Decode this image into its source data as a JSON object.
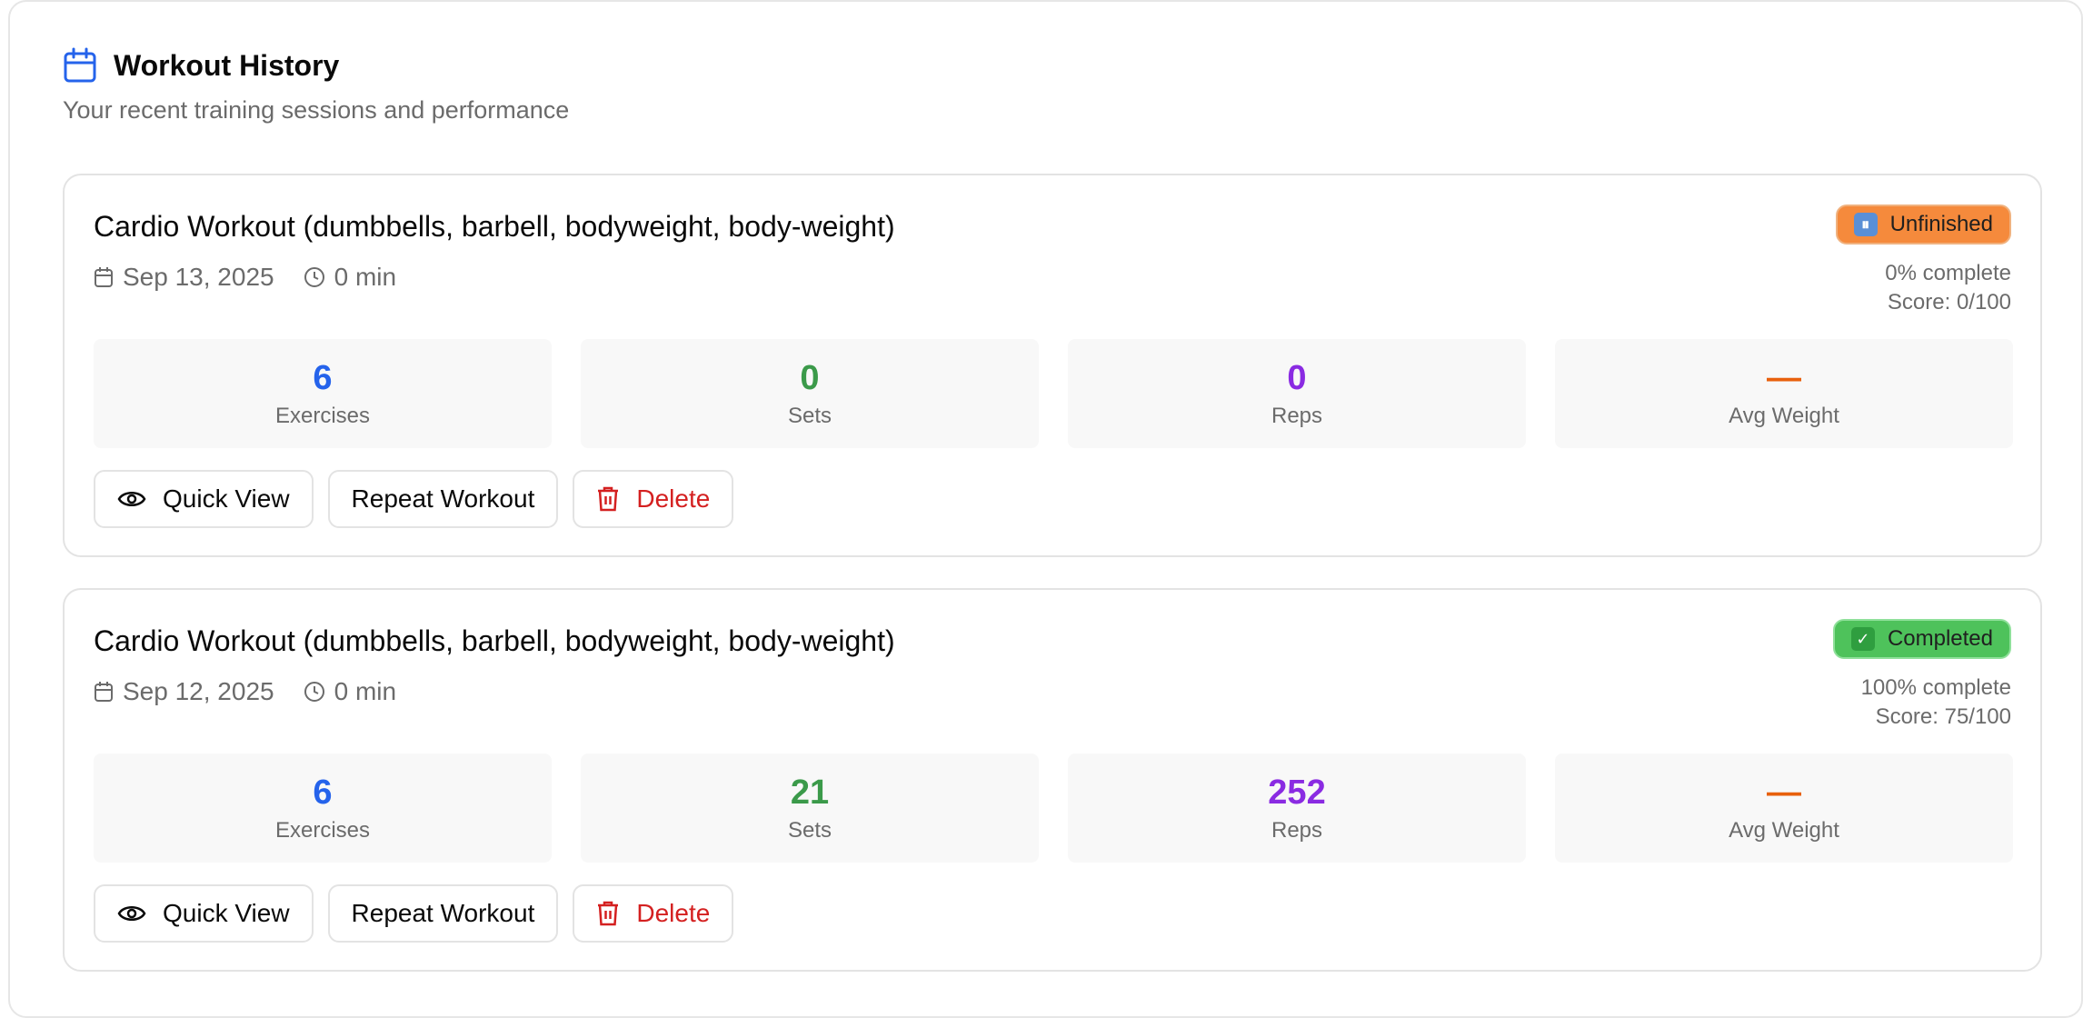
{
  "header": {
    "title": "Workout History",
    "subtitle": "Your recent training sessions and performance"
  },
  "colors": {
    "accent_blue": "#2563eb",
    "sets_green": "#3b9a4a",
    "reps_purple": "#8a2be2",
    "weight_orange": "#e8600c",
    "unfinished_badge": "#f58a3c",
    "completed_badge": "#4ec25b",
    "delete_red": "#d42020"
  },
  "workouts": [
    {
      "title": "Cardio Workout (dumbbells, barbell, bodyweight, body-weight)",
      "date": "Sep 13, 2025",
      "duration": "0 min",
      "status_icon": "pause-emoji",
      "status_label": "Unfinished",
      "status_glyph": "⏸",
      "complete": "0% complete",
      "score": "Score: 0/100",
      "stats": [
        {
          "value": "6",
          "label": "Exercises"
        },
        {
          "value": "0",
          "label": "Sets"
        },
        {
          "value": "0",
          "label": "Reps"
        },
        {
          "value": "—",
          "label": "Avg Weight"
        }
      ],
      "actions": {
        "quick_view": "Quick View",
        "repeat": "Repeat Workout",
        "delete": "Delete"
      }
    },
    {
      "title": "Cardio Workout (dumbbells, barbell, bodyweight, body-weight)",
      "date": "Sep 12, 2025",
      "duration": "0 min",
      "status_icon": "check-emoji",
      "status_label": "Completed",
      "status_glyph": "✓",
      "complete": "100% complete",
      "score": "Score: 75/100",
      "stats": [
        {
          "value": "6",
          "label": "Exercises"
        },
        {
          "value": "21",
          "label": "Sets"
        },
        {
          "value": "252",
          "label": "Reps"
        },
        {
          "value": "—",
          "label": "Avg Weight"
        }
      ],
      "actions": {
        "quick_view": "Quick View",
        "repeat": "Repeat Workout",
        "delete": "Delete"
      }
    }
  ]
}
